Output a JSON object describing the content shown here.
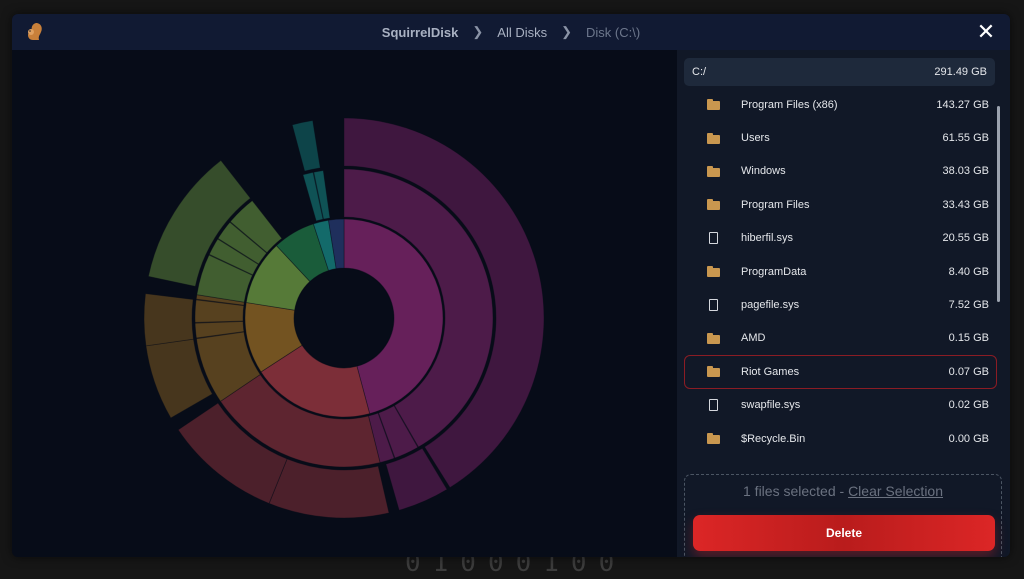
{
  "background_digits": "01000100",
  "titlebar": {
    "app_icon": "squirrel-icon",
    "breadcrumbs": [
      "SquirrelDisk",
      "All Disks",
      "Disk (C:\\)"
    ],
    "close_icon": "close-icon"
  },
  "chart_data": {
    "type": "sunburst",
    "segments": [
      {
        "name": "Program Files (x86)",
        "color": "#66205a"
      },
      {
        "name": "Users",
        "color": "#7c2e38"
      },
      {
        "name": "Windows",
        "color": "#735321"
      },
      {
        "name": "Program Files",
        "color": "#567a38"
      },
      {
        "name": "hiberfil.sys",
        "color": "#1a5c3a"
      },
      {
        "name": "ProgramData",
        "color": "#136a6a"
      },
      {
        "name": "pagefile.sys",
        "color": "#1f2f5c"
      }
    ]
  },
  "panel": {
    "root": {
      "name": "C:/",
      "size": "291.49 GB"
    },
    "items": [
      {
        "name": "Program Files (x86)",
        "size": "143.27 GB",
        "type": "folder"
      },
      {
        "name": "Users",
        "size": "61.55 GB",
        "type": "folder"
      },
      {
        "name": "Windows",
        "size": "38.03 GB",
        "type": "folder"
      },
      {
        "name": "Program Files",
        "size": "33.43 GB",
        "type": "folder"
      },
      {
        "name": "hiberfil.sys",
        "size": "20.55 GB",
        "type": "file"
      },
      {
        "name": "ProgramData",
        "size": "8.40 GB",
        "type": "folder"
      },
      {
        "name": "pagefile.sys",
        "size": "7.52 GB",
        "type": "file"
      },
      {
        "name": "AMD",
        "size": "0.15 GB",
        "type": "folder"
      },
      {
        "name": "Riot Games",
        "size": "0.07 GB",
        "type": "folder",
        "selected": true
      },
      {
        "name": "swapfile.sys",
        "size": "0.02 GB",
        "type": "file"
      },
      {
        "name": "$Recycle.Bin",
        "size": "0.00 GB",
        "type": "folder"
      }
    ],
    "selection_text": "1 files selected - ",
    "clear_selection": "Clear Selection",
    "delete_label": "Delete",
    "selected_color": "#8b1c24",
    "delete_color": "#dc2626"
  }
}
